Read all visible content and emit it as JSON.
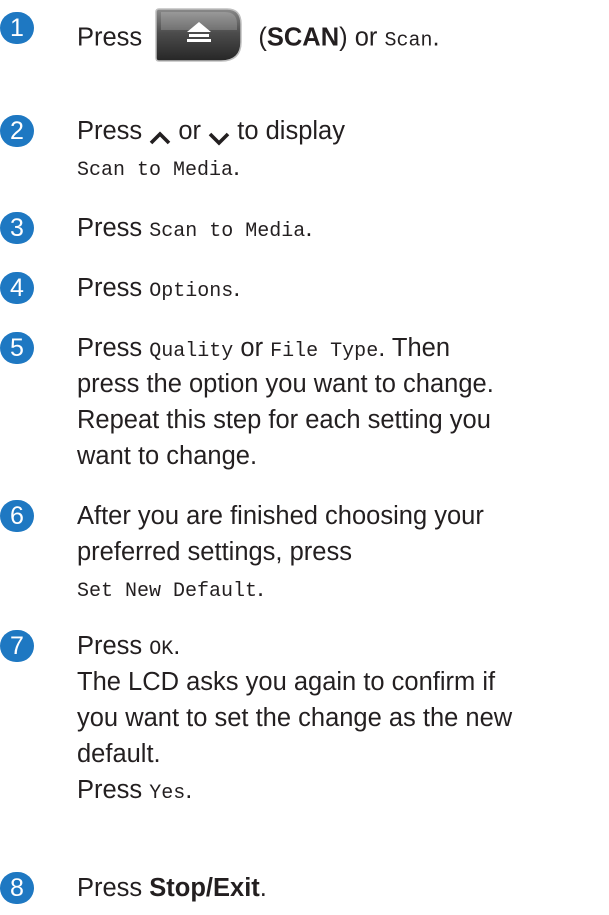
{
  "steps": [
    {
      "num": "1",
      "press": "Press",
      "paren_open": "(",
      "scan_bold": "SCAN",
      "paren_close": ") or",
      "scan_mono": "Scan",
      "period": "."
    },
    {
      "num": "2",
      "press": "Press",
      "or": "or",
      "to_display": "to display",
      "value": "Scan to Media",
      "period": "."
    },
    {
      "num": "3",
      "press": "Press",
      "value": "Scan to Media",
      "period": "."
    },
    {
      "num": "4",
      "press": "Press",
      "value": "Options",
      "period": "."
    },
    {
      "num": "5",
      "press": "Press",
      "value1": "Quality",
      "or": "or",
      "value2": "File Type",
      "then": ". Then",
      "line2": "press the option you want to change.",
      "line3": "Repeat this step for each setting you",
      "line4": "want to change."
    },
    {
      "num": "6",
      "line1": "After you are finished choosing your",
      "line2": "preferred settings, press",
      "value": "Set New Default",
      "period": "."
    },
    {
      "num": "7",
      "press": "Press",
      "value": "OK",
      "period": ".",
      "line2": "The LCD asks you again to confirm if",
      "line3": "you want to set the change as the new",
      "line4": "default.",
      "press2": "Press",
      "value2": "Yes",
      "period2": "."
    },
    {
      "num": "8",
      "press": "Press",
      "bold": "Stop/Exit",
      "period": "."
    }
  ],
  "icons": {
    "scan": "scan-key-icon",
    "up": "up-arrow-icon",
    "down": "down-arrow-icon"
  },
  "colors": {
    "step_badge": "#1e78c2",
    "scan_key_bg": "#4a4a4a"
  }
}
